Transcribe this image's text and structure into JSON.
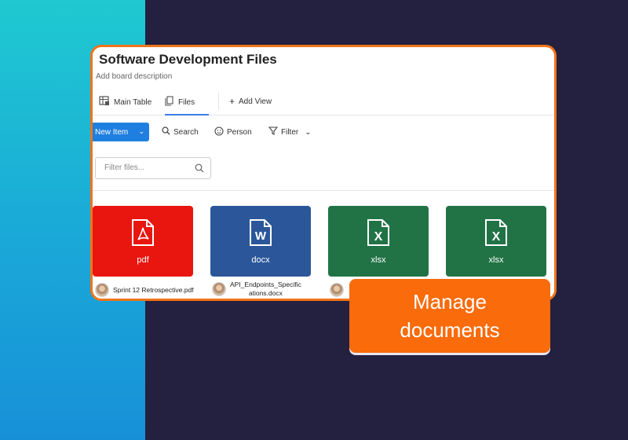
{
  "board": {
    "title": "Software Development Files",
    "description": "Add board description"
  },
  "tabs": [
    {
      "label": "Main Table",
      "icon": "table-icon"
    },
    {
      "label": "Files",
      "icon": "file-icon"
    },
    {
      "label": "Add View",
      "icon": "plus-icon"
    }
  ],
  "toolbar": {
    "new_item_label": "New Item",
    "search_label": "Search",
    "person_label": "Person",
    "filter_label": "Filter"
  },
  "filter_files": {
    "placeholder": "Filter files..."
  },
  "files": [
    {
      "type": "pdf",
      "color": "#e8160f",
      "letter": "",
      "name": "Sprint 12 Retrospective.pdf"
    },
    {
      "type": "docx",
      "color": "#2b579a",
      "letter": "W",
      "name_line1": "API_Endpoints_Specific",
      "name_line2": "ations.docx"
    },
    {
      "type": "xlsx",
      "color": "#217346",
      "letter": "X",
      "name": ""
    },
    {
      "type": "xlsx",
      "color": "#217346",
      "letter": "X",
      "name": ""
    }
  ],
  "cta": {
    "line1": "Manage",
    "line2": "documents"
  },
  "colors": {
    "background": "#24203f",
    "accent_orange": "#f96b0b",
    "primary_blue": "#1f7fe0"
  }
}
